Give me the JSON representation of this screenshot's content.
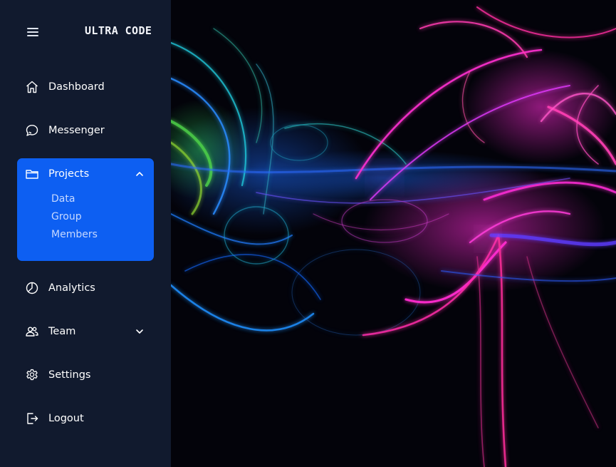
{
  "brand": {
    "name": "ULTRA CODE"
  },
  "menu": {
    "toggle_icon": "hamburger-icon",
    "items": [
      {
        "label": "Dashboard",
        "icon": "home-icon"
      },
      {
        "label": "Messenger",
        "icon": "chat-icon"
      },
      {
        "label": "Projects",
        "icon": "folder-icon",
        "expanded": true,
        "children": [
          "Data",
          "Group",
          "Members"
        ]
      },
      {
        "label": "Analytics",
        "icon": "pie-chart-icon"
      },
      {
        "label": "Team",
        "icon": "users-icon",
        "expanded": false
      },
      {
        "label": "Settings",
        "icon": "gear-icon"
      },
      {
        "label": "Logout",
        "icon": "logout-icon"
      }
    ]
  },
  "colors": {
    "sidebar_bg": "#111a2e",
    "active_bg": "#0d5ff2",
    "submenu_text": "#c6d8ff",
    "hero_bg": "#020208"
  }
}
